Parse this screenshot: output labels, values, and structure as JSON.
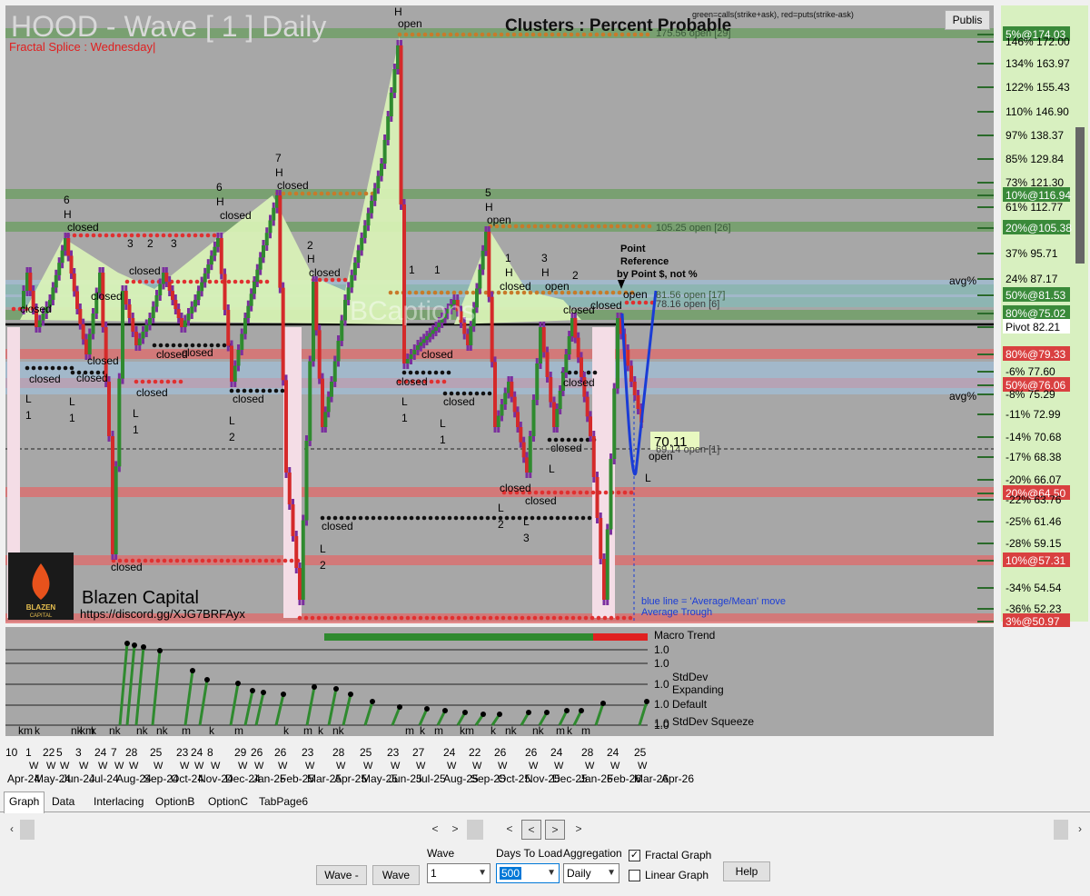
{
  "chart": {
    "title": "HOOD - Wave [ 1 ] Daily",
    "subtitle": "Fractal Splice : Wednesday|",
    "clusters_title": "Clusters : Percent Probable",
    "legend_top": "green=calls(strike+ask), red=puts(strike-ask)",
    "publish_label": "Publis",
    "watermark": "BCaptions",
    "brand_name": "Blazen Capital",
    "brand_url": "https://discord.gg/XJG7BRFAyx",
    "logo_text": "BLAZEN",
    "logo_sub": "CAPITAL",
    "point_reference": [
      "Point",
      "Reference",
      "by Point $, not %"
    ],
    "current_price_label": "70.11",
    "avg_label": "avg%",
    "blue_note": [
      "blue line = 'Average/Mean' move",
      "Average Trough"
    ],
    "level_notes": [
      "105.25 open [26]",
      "81.56 open [17]",
      "78.16 open [6]",
      "69.14 open [1]"
    ],
    "level_note_top": "175.56 open [29]"
  },
  "price_scale": [
    {
      "text": "5%@174.03",
      "style": "green-box"
    },
    {
      "text": "146% 172.00",
      "style": "plain"
    },
    {
      "text": "134% 163.97",
      "style": "plain"
    },
    {
      "text": "122% 155.43",
      "style": "plain"
    },
    {
      "text": "110% 146.90",
      "style": "plain"
    },
    {
      "text": "97% 138.37",
      "style": "plain"
    },
    {
      "text": "85% 129.84",
      "style": "plain"
    },
    {
      "text": "73% 121.30",
      "style": "plain"
    },
    {
      "text": "10%@116.94",
      "style": "green-box"
    },
    {
      "text": "61% 112.77",
      "style": "plain"
    },
    {
      "text": "20%@105.38",
      "style": "green-box"
    },
    {
      "text": "37% 95.71",
      "style": "plain"
    },
    {
      "text": "24% 87.17",
      "style": "plain"
    },
    {
      "text": "50%@81.53",
      "style": "green-box"
    },
    {
      "text": "80%@75.02",
      "style": "green-box"
    },
    {
      "text": "Pivot 82.21",
      "style": "pivot"
    },
    {
      "text": "80%@79.33",
      "style": "red-box"
    },
    {
      "text": "-6% 77.60",
      "style": "plain"
    },
    {
      "text": "50%@76.06",
      "style": "red-box"
    },
    {
      "text": "-8% 75.29",
      "style": "plain"
    },
    {
      "text": "-11% 72.99",
      "style": "plain"
    },
    {
      "text": "-14% 70.68",
      "style": "plain"
    },
    {
      "text": "-17% 68.38",
      "style": "plain"
    },
    {
      "text": "-20% 66.07",
      "style": "plain"
    },
    {
      "text": "20%@64.50",
      "style": "red-box"
    },
    {
      "text": "-22% 63.76",
      "style": "plain"
    },
    {
      "text": "-25% 61.46",
      "style": "plain"
    },
    {
      "text": "-28% 59.15",
      "style": "plain"
    },
    {
      "text": "10%@57.31",
      "style": "red-box"
    },
    {
      "text": "-34% 54.54",
      "style": "plain"
    },
    {
      "text": "-36% 52.23",
      "style": "plain"
    },
    {
      "text": "3%@50.97",
      "style": "red-box"
    }
  ],
  "lower_panel": {
    "labels": [
      "Macro Trend",
      "1.0",
      "1.0",
      "StdDev",
      "1.0",
      "Expanding",
      "Default",
      "1.0",
      "1.0",
      "StdDev Squeeze",
      "1.0"
    ],
    "k_row": [
      "km",
      "k",
      "nk",
      "km",
      "k",
      "nk",
      "nk",
      "nk",
      "m",
      "k",
      "m",
      "k",
      "m",
      "k",
      "nk",
      "m",
      "k",
      "m",
      "km",
      "k",
      "nk",
      "nk",
      "m",
      "k",
      "m"
    ]
  },
  "x_axis": {
    "days": [
      "10",
      "1",
      "22",
      "5",
      "3",
      "24",
      "7",
      "28",
      "25",
      "23",
      "24",
      "8",
      "29",
      "26",
      "26",
      "23",
      "28",
      "25",
      "23",
      "27",
      "24",
      "22",
      "26",
      "26",
      "24",
      "28",
      "24",
      "25"
    ],
    "months": [
      "Apr-24",
      "May-24",
      "Jun-24",
      "Jul-24",
      "Aug-24",
      "Sep-24",
      "Oct-24",
      "Nov-24",
      "Dec-24",
      "Jan-25",
      "Feb-25",
      "Mar-25",
      "Apr-25",
      "May-25",
      "Jun-25",
      "Jul-25",
      "Aug-25",
      "Sep-25",
      "Oct-25",
      "Nov-25",
      "Dec-25",
      "Jan-26",
      "Feb-26",
      "Mar-26",
      "Apr-26"
    ]
  },
  "tabs": [
    "Graph",
    "Data",
    "Interlacing",
    "OptionB",
    "OptionC",
    "TabPage6"
  ],
  "controls": {
    "wave_minus": "Wave -",
    "wave_plus": "Wave",
    "wave_label": "Wave",
    "wave_value": "1",
    "days_label": "Days To Load",
    "days_value": "500",
    "aggregation_label": "Aggregation",
    "aggregation_value": "Daily",
    "fractal_graph": "Fractal Graph",
    "fractal_checked": "✓",
    "linear_graph": "Linear Graph",
    "help": "Help"
  },
  "scroll": {
    "left": "‹",
    "right": "›",
    "prev": "<",
    "next": ">",
    "dprev": "<",
    "dnext": ">"
  },
  "colors": {
    "chart_bg": "#a7a7a7",
    "green_band": "#6a9e5f",
    "red_band": "#e06a6a",
    "blue_band": "#9ec7e8",
    "candle_up": "#2f8a2f",
    "candle_down": "#d42a2a",
    "wick": "#7b2f9e",
    "mean_line": "#1a3cd6",
    "scale_green": "#3a8a3a",
    "scale_red": "#d94040",
    "scale_bg": "#d8f0c0"
  }
}
